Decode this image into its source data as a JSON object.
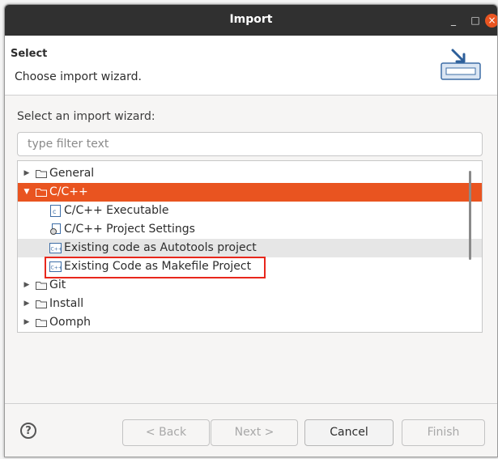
{
  "background": {
    "text": "..."
  },
  "window": {
    "title": "Import",
    "close_glyph": "×",
    "minimize_glyph": "_",
    "maximize_glyph": "□"
  },
  "header": {
    "title": "Select",
    "description": "Choose import wizard.",
    "icon": "import-wizard-icon"
  },
  "wizard_prompt": "Select an import wizard:",
  "filter": {
    "placeholder": "type filter text",
    "value": ""
  },
  "tree": {
    "items": [
      {
        "label": "General",
        "type": "folder",
        "level": 0,
        "expanded": false,
        "selected": false
      },
      {
        "label": "C/C++",
        "type": "folder",
        "level": 0,
        "expanded": true,
        "selected": true
      },
      {
        "label": "C/C++ Executable",
        "type": "file",
        "level": 1,
        "icon": "c-file-icon"
      },
      {
        "label": "C/C++ Project Settings",
        "type": "file",
        "level": 1,
        "icon": "settings-file-icon"
      },
      {
        "label": "Existing code as Autotools project",
        "type": "file",
        "level": 1,
        "icon": "cpp-file-icon",
        "hover": true
      },
      {
        "label": "Existing Code as Makefile Project",
        "type": "file",
        "level": 1,
        "icon": "cpp-file-icon",
        "highlighted": true
      },
      {
        "label": "Git",
        "type": "folder",
        "level": 0,
        "expanded": false
      },
      {
        "label": "Install",
        "type": "folder",
        "level": 0,
        "expanded": false
      },
      {
        "label": "Oomph",
        "type": "folder",
        "level": 0,
        "expanded": false
      }
    ]
  },
  "buttons": {
    "back": "< Back",
    "next": "Next >",
    "cancel": "Cancel",
    "finish": "Finish"
  },
  "colors": {
    "selection": "#e95420",
    "highlight_box": "#e8271c",
    "titlebar": "#303030"
  }
}
